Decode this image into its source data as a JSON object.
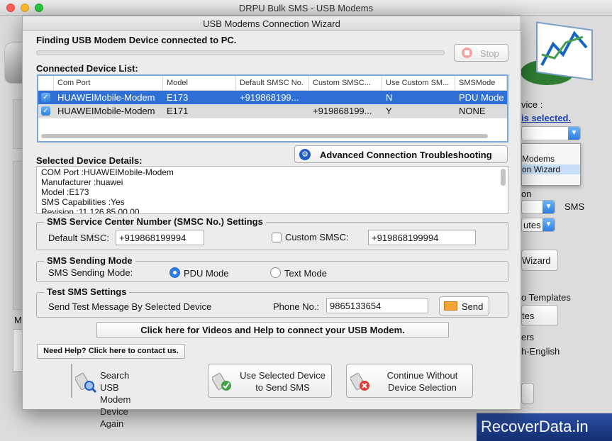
{
  "main_window": {
    "title": "DRPU Bulk SMS - USB Modems",
    "bg_labels": {
      "device": "vice :",
      "selected_link": "is selected.",
      "menu_item1": "Modems",
      "menu_item2": "on  Wizard",
      "option": "on",
      "sms": "SMS",
      "minutes": "utes",
      "wizard_btn": "Wizard",
      "templates": "o Templates",
      "tes_btn": "tes",
      "ers": "ers",
      "english": "h-English",
      "left_m": "M"
    }
  },
  "dialog": {
    "title": "USB Modems Connection Wizard",
    "finding_text": "Finding USB Modem Device connected to PC.",
    "stop_label": "Stop",
    "device_list_label": "Connected Device List:",
    "columns": [
      "Com Port",
      "Model",
      "Default SMSC No.",
      "Custom SMSC...",
      "Use Custom SM...",
      "SMSMode"
    ],
    "rows": [
      {
        "checked": true,
        "com_port": "HUAWEIMobile-Modem",
        "model": "E173",
        "default_smsc": "+919868199...",
        "custom_smsc": "",
        "use_custom": "N",
        "mode": "PDU Mode"
      },
      {
        "checked": true,
        "com_port": "HUAWEIMobile-Modem",
        "model": "E171",
        "default_smsc": "",
        "custom_smsc": "+919868199...",
        "use_custom": "Y",
        "mode": "NONE"
      }
    ],
    "advanced_button": "Advanced Connection Troubleshooting",
    "selected_details_label": "Selected Device Details:",
    "details_lines": [
      "COM Port :HUAWEIMobile-Modem",
      "Manufacturer :huawei",
      "Model :E173",
      "SMS Capabilities :Yes",
      "Revision :11.126.85.00.00"
    ],
    "smsc_group": {
      "legend": "SMS Service Center Number (SMSC No.) Settings",
      "default_label": "Default SMSC:",
      "default_value": "+919868199994",
      "custom_label": "Custom SMSC:",
      "custom_checked": false,
      "custom_value": "+919868199994"
    },
    "mode_group": {
      "legend": "SMS Sending Mode",
      "label": "SMS Sending Mode:",
      "pdu_label": "PDU Mode",
      "text_label": "Text Mode",
      "selected": "PDU Mode"
    },
    "test_group": {
      "legend": "Test SMS Settings",
      "label": "Send Test Message By Selected Device",
      "phone_label": "Phone No.:",
      "phone_value": "9865133654",
      "send_label": "Send"
    },
    "help_video_button": "Click here for Videos and Help to connect your USB Modem.",
    "need_help_button": "Need Help? Click here to contact us.",
    "bottom_buttons": [
      {
        "line1": "Search USB Modem",
        "line2": "Device Again"
      },
      {
        "line1": "Use Selected Device",
        "line2": "to Send SMS"
      },
      {
        "line1": "Continue Without",
        "line2": "Device Selection"
      }
    ]
  },
  "watermark": "RecoverData.in",
  "colors": {
    "selection": "#2f6fd6",
    "accent_blue": "#2e7fe0",
    "watermark_bg": "#1e3f8a"
  }
}
